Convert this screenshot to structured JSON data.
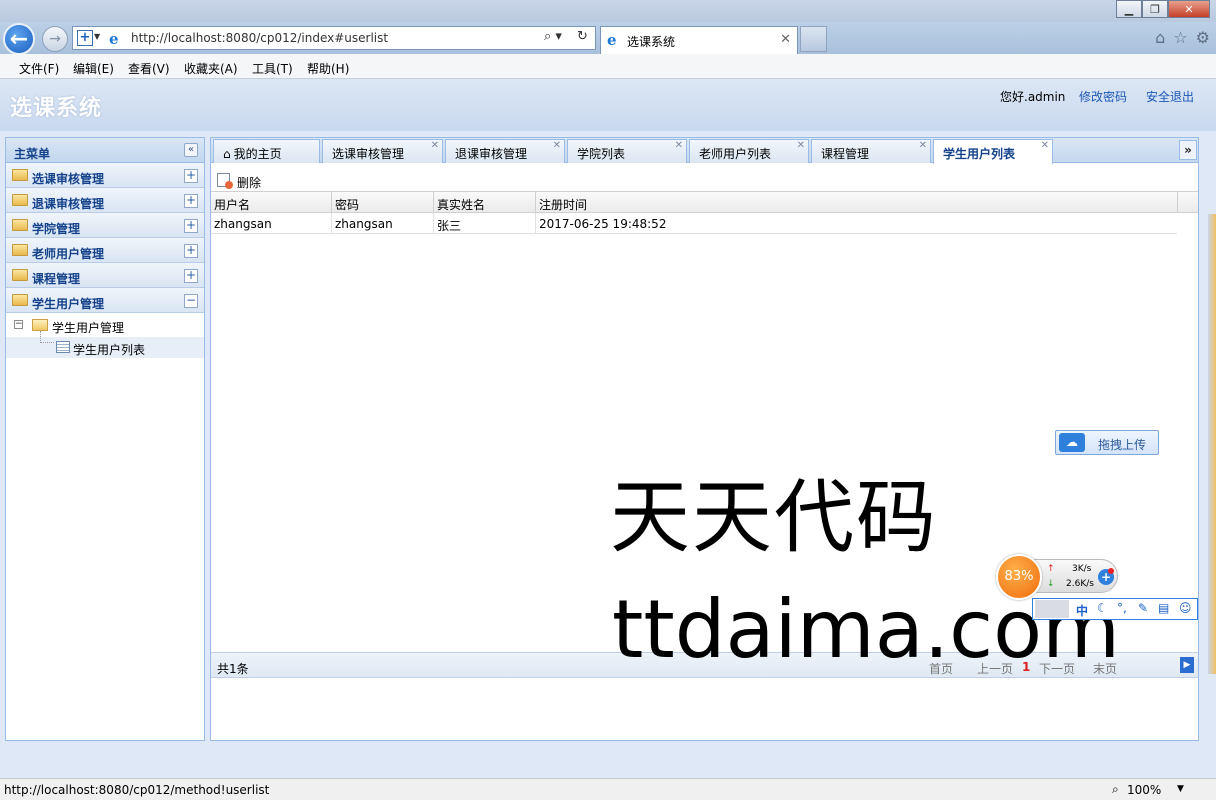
{
  "browser": {
    "address": "http://localhost:8080/cp012/index#userlist",
    "tab_title": "选课系统",
    "menu": [
      "文件(F)",
      "编辑(E)",
      "查看(V)",
      "收藏夹(A)",
      "工具(T)",
      "帮助(H)"
    ],
    "status_url": "http://localhost:8080/cp012/method!userlist",
    "zoom": "100%"
  },
  "app": {
    "title": "选课系统",
    "greeting": "您好.admin",
    "change_password": "修改密码",
    "logout": "安全退出"
  },
  "sidebar": {
    "title": "主菜单",
    "collapse_glyph": "«",
    "items": [
      {
        "label": "选课审核管理",
        "toggle": "+"
      },
      {
        "label": "退课审核管理",
        "toggle": "+"
      },
      {
        "label": "学院管理",
        "toggle": "+"
      },
      {
        "label": "老师用户管理",
        "toggle": "+"
      },
      {
        "label": "课程管理",
        "toggle": "+"
      },
      {
        "label": "学生用户管理",
        "toggle": "−"
      }
    ],
    "tree": {
      "node": "学生用户管理",
      "leaf": "学生用户列表"
    }
  },
  "tabs": [
    {
      "label": "我的主页",
      "closable": false
    },
    {
      "label": "选课审核管理",
      "closable": true
    },
    {
      "label": "退课审核管理",
      "closable": true
    },
    {
      "label": "学院列表",
      "closable": true
    },
    {
      "label": "老师用户列表",
      "closable": true
    },
    {
      "label": "课程管理",
      "closable": true
    },
    {
      "label": "学生用户列表",
      "closable": true,
      "active": true
    }
  ],
  "toolbar": {
    "delete_label": "删除"
  },
  "grid": {
    "columns": [
      "用户名",
      "密码",
      "真实姓名",
      "注册时间"
    ],
    "rows": [
      [
        "zhangsan",
        "zhangsan",
        "张三",
        "2017-06-25 19:48:52"
      ]
    ]
  },
  "pager": {
    "total": "共1条",
    "first": "首页",
    "prev": "上一页",
    "current": "1",
    "next": "下一页",
    "last": "末页"
  },
  "widgets": {
    "upload_label": "拖拽上传",
    "speed_percent": "83%",
    "upload_speed": "3K/s",
    "download_speed": "2.6K/s",
    "ime_mode": "中"
  },
  "watermark": {
    "line1": "天天代码",
    "line2": "ttdaima.com"
  },
  "colors": {
    "accent": "#15428b",
    "link": "#1a57b5",
    "border": "#99bbe8"
  }
}
